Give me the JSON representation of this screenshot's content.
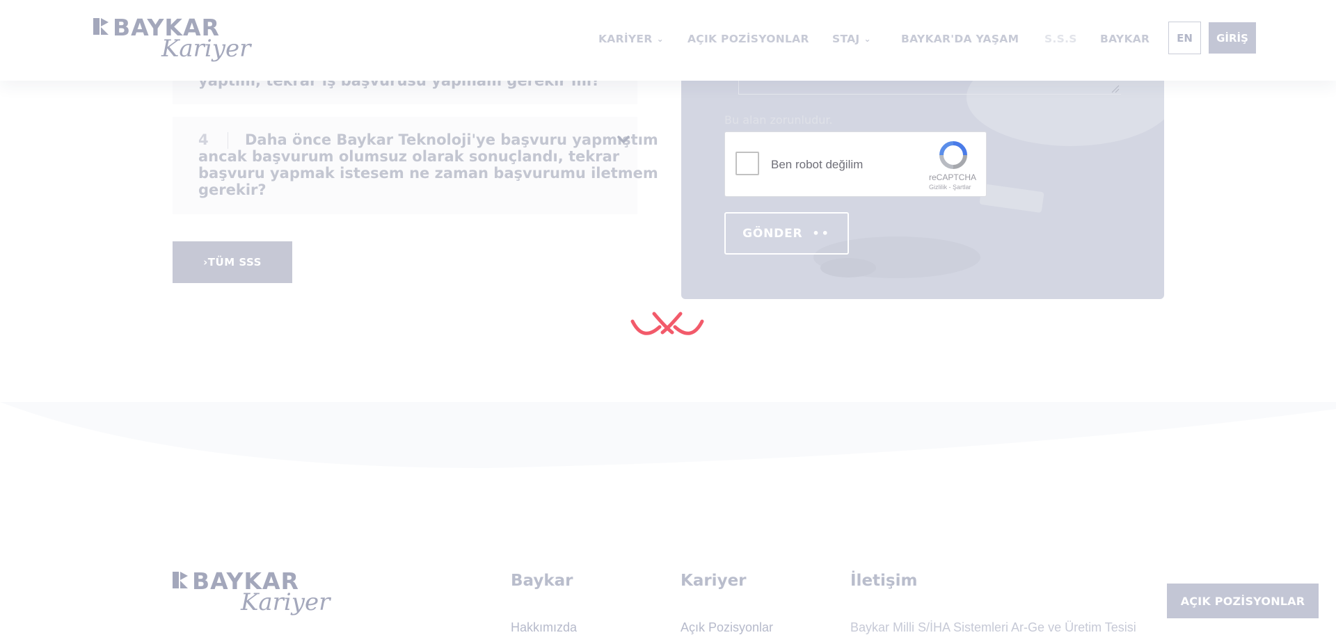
{
  "header": {
    "logo": {
      "brand": "BAYKAR",
      "script": "Kariyer"
    },
    "nav": [
      {
        "label": "KARİYER",
        "dropdown": true
      },
      {
        "label": "AÇIK POZİSYONLAR",
        "dropdown": false
      },
      {
        "label": "STAJ",
        "dropdown": true
      },
      {
        "label": "BAYKAR'DA YAŞAM",
        "dropdown": false
      },
      {
        "label": "S.S.S",
        "dropdown": false
      },
      {
        "label": "BAYKAR",
        "dropdown": false
      }
    ],
    "lang": "EN",
    "login": "GİRİŞ"
  },
  "faq": {
    "item3_partial": "yaptım, tekrar iş başvurusu yapmam gerekir mi?",
    "item4": {
      "number": "4",
      "lines": [
        "Daha önce Baykar Teknoloji'ye başvuru yapmıştım",
        "ancak başvurum olumsuz olarak sonuçlandı, tekrar",
        "başvuru yapmak istesem ne zaman başvurumu iletmem",
        "gerekir?"
      ]
    },
    "all_button": "›TÜM SSS"
  },
  "form": {
    "required_msg": "Bu alan zorunludur.",
    "captcha": {
      "label": "Ben robot değilim",
      "brand": "reCAPTCHA",
      "terms": "Gizlilik - Şartlar"
    },
    "submit": "GÖNDER"
  },
  "footer": {
    "logo": {
      "brand": "BAYKAR",
      "script": "Kariyer"
    },
    "columns": [
      {
        "title": "Baykar",
        "first_link": "Hakkımızda"
      },
      {
        "title": "Kariyer",
        "first_link": "Açık Pozisyonlar"
      },
      {
        "title": "İletişim",
        "first_link": "Baykar Milli S/İHA Sistemleri Ar-Ge ve Üretim Tesisi"
      }
    ]
  },
  "floating_button": "AÇIK POZİSYONLAR",
  "colors": {
    "accent": "#c3c6d5",
    "loader": "#f25a6a",
    "panel": "#d3d6e2"
  }
}
